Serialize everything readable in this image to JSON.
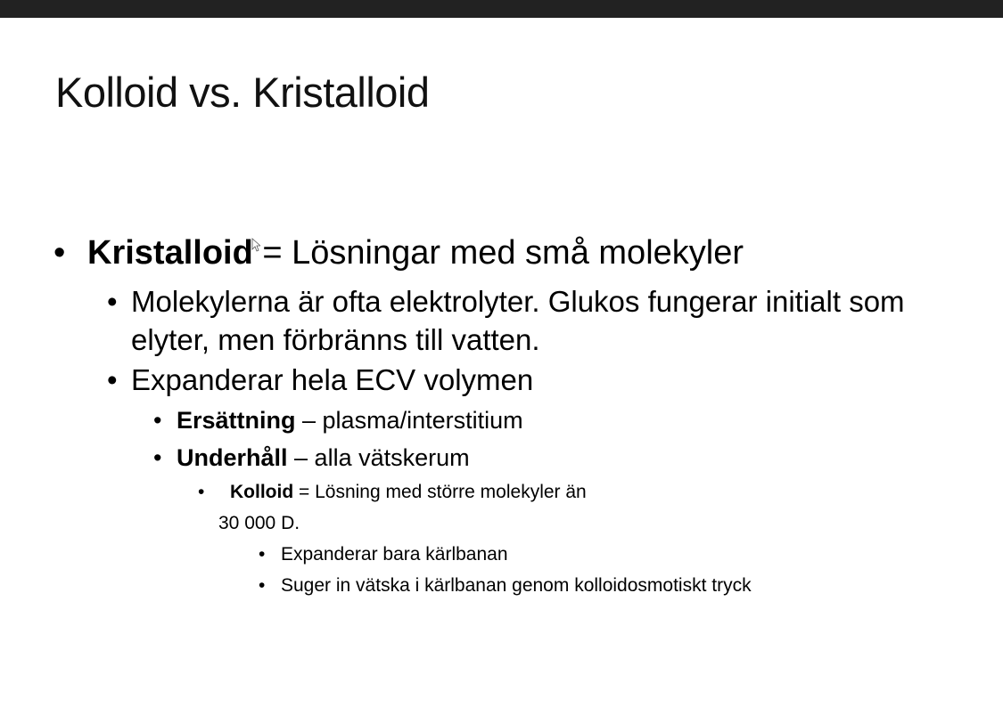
{
  "slide": {
    "title": "Kolloid vs. Kristalloid",
    "bullet_char": "•",
    "items": [
      {
        "bold": "Kristalloid",
        "text": " = Lösningar med små molekyler"
      },
      {
        "text": "Molekylerna är ofta elektrolyter. Glukos fungerar initialt som elyter, men förbränns till vatten."
      },
      {
        "text": "Expanderar hela ECV volymen"
      },
      {
        "bold": "Ersättning",
        "text": " – plasma/interstitium"
      },
      {
        "bold": "Underhåll",
        "text": " – alla vätskerum"
      },
      {
        "bold": "Kolloid",
        "text": " = Lösning med större molekyler än",
        "continuation": "30 000 D."
      },
      {
        "text": "Expanderar bara kärlbanan"
      },
      {
        "text": "Suger in vätska i kärlbanan genom kolloidosmotiskt tryck"
      }
    ]
  },
  "colors": {
    "topbar": "#222222",
    "background": "#ffffff",
    "text": "#000000"
  },
  "icons": {
    "cursor": "mouse-pointer-icon"
  }
}
